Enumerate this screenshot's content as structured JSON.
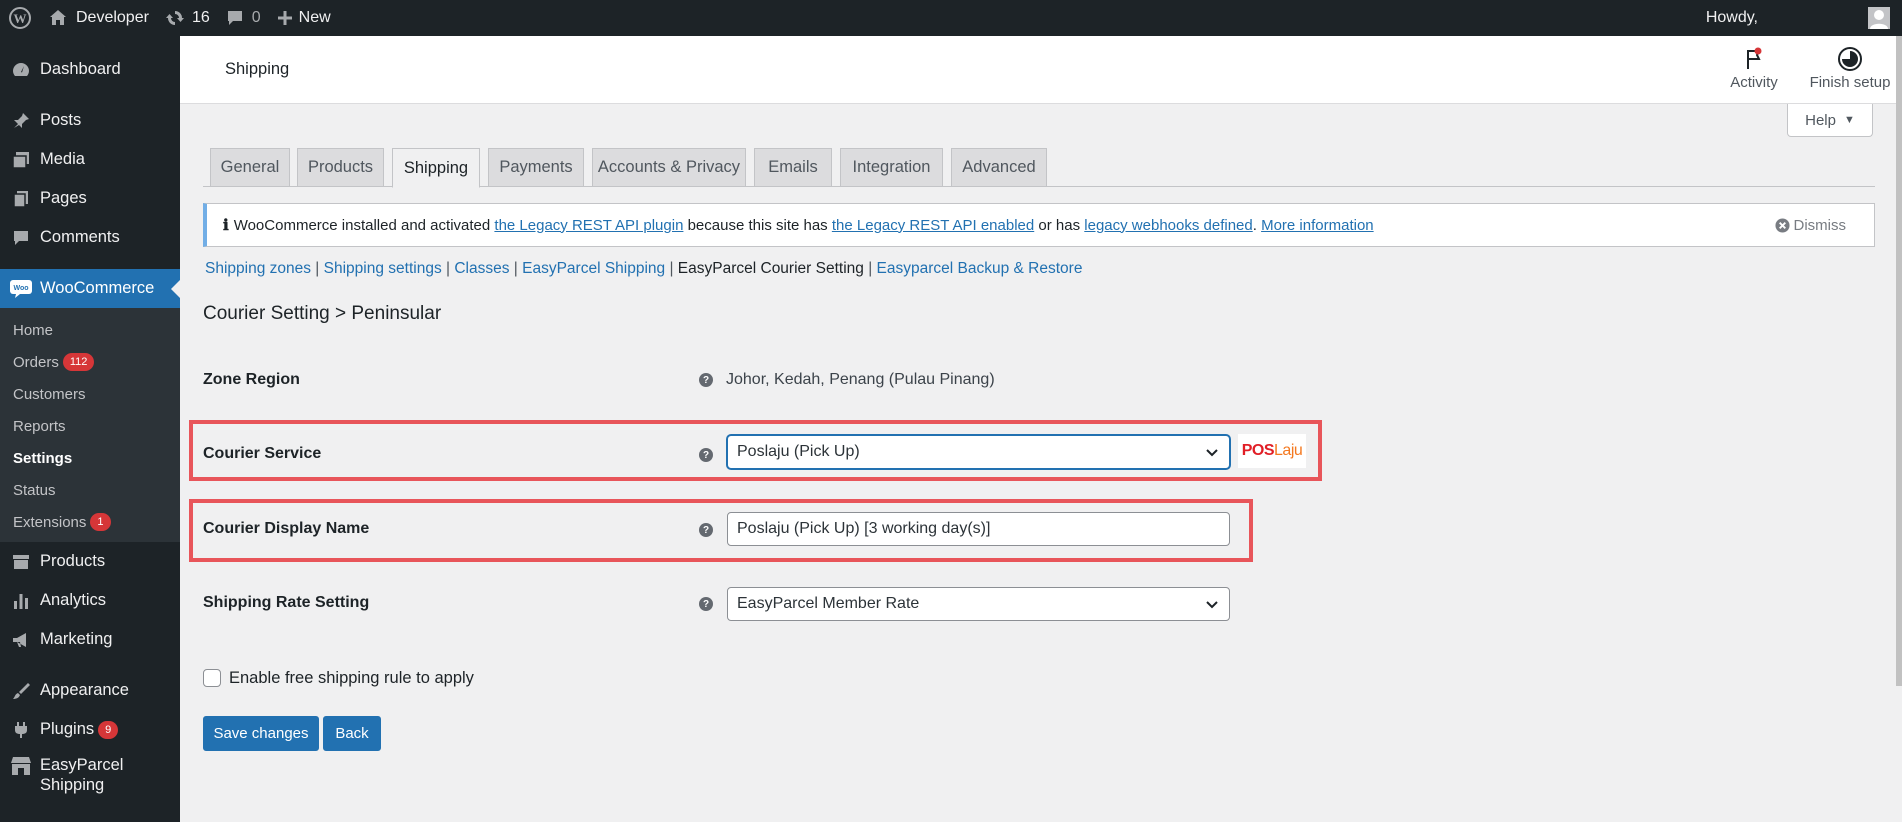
{
  "adminbar": {
    "site_name": "Developer",
    "updates_count": "16",
    "comments_count": "0",
    "new_label": "New",
    "howdy": "Howdy,"
  },
  "sidebar": {
    "items": [
      {
        "label": "Dashboard",
        "icon": "dashboard-icon"
      },
      {
        "label": "Posts",
        "icon": "pin-icon"
      },
      {
        "label": "Media",
        "icon": "media-icon"
      },
      {
        "label": "Pages",
        "icon": "pages-icon"
      },
      {
        "label": "Comments",
        "icon": "comment-icon"
      },
      {
        "label": "WooCommerce",
        "icon": "woo-icon"
      },
      {
        "label": "Products",
        "icon": "archive-icon"
      },
      {
        "label": "Analytics",
        "icon": "bar-chart-icon"
      },
      {
        "label": "Marketing",
        "icon": "megaphone-icon"
      },
      {
        "label": "Appearance",
        "icon": "brush-icon"
      },
      {
        "label": "Plugins",
        "icon": "plug-icon",
        "badge": "9"
      },
      {
        "label": "EasyParcel Shipping",
        "icon": "store-icon"
      }
    ],
    "woo_submenu": [
      {
        "label": "Home"
      },
      {
        "label": "Orders",
        "badge": "112"
      },
      {
        "label": "Customers"
      },
      {
        "label": "Reports"
      },
      {
        "label": "Settings"
      },
      {
        "label": "Status"
      },
      {
        "label": "Extensions",
        "badge": "1"
      }
    ]
  },
  "header": {
    "title": "Shipping",
    "activity_label": "Activity",
    "finish_setup_label": "Finish setup",
    "help_label": "Help"
  },
  "tabs": [
    "General",
    "Products",
    "Shipping",
    "Payments",
    "Accounts & Privacy",
    "Emails",
    "Integration",
    "Advanced"
  ],
  "notice": {
    "icon": "info-icon",
    "t1": "WooCommerce installed and activated",
    "link1": "the Legacy REST API plugin",
    "t2": "because this site has",
    "link2": "the Legacy REST API enabled",
    "t3": "or has",
    "link3": "legacy webhooks defined",
    "t4": ".",
    "link4": "More information",
    "dismiss": "Dismiss"
  },
  "subnav": [
    {
      "label": "Shipping zones"
    },
    {
      "label": "Shipping settings"
    },
    {
      "label": "Classes"
    },
    {
      "label": "EasyParcel Shipping"
    },
    {
      "label": "EasyParcel Courier Setting"
    },
    {
      "label": "Easyparcel Backup & Restore"
    }
  ],
  "breadcrumb": "Courier Setting > Peninsular",
  "form": {
    "zone_label": "Zone Region",
    "zone_value": "Johor, Kedah, Penang (Pulau Pinang)",
    "courier_label": "Courier Service",
    "courier_value": "Poslaju (Pick Up)",
    "logo_pos": "POS",
    "logo_laju": "Laju",
    "display_label": "Courier Display Name",
    "display_value": "Poslaju (Pick Up) [3 working day(s)]",
    "rate_label": "Shipping Rate Setting",
    "rate_value": "EasyParcel Member Rate",
    "free_shipping_label": "Enable free shipping rule to apply",
    "save_label": "Save changes",
    "back_label": "Back"
  },
  "colors": {
    "admin_bg": "#1d2327",
    "accent": "#2271b1",
    "highlight": "#e8555a"
  }
}
